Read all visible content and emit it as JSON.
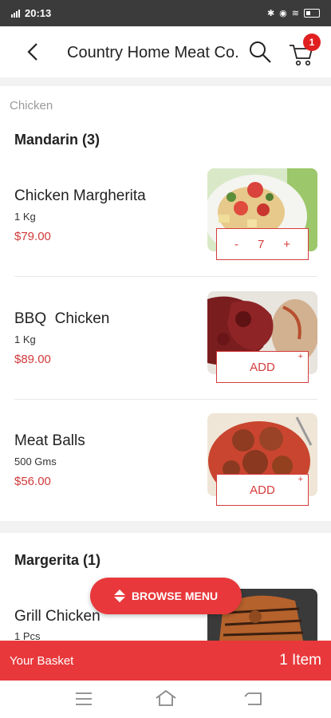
{
  "status_bar": {
    "time": "20:13"
  },
  "header": {
    "title": "Country Home Meat Co.",
    "cart_count": "1"
  },
  "breadcrumb": "Chicken",
  "sections": [
    {
      "title": "Mandarin (3)",
      "items": [
        {
          "name": "Chicken Margherita",
          "qty": "1 Kg",
          "price": "$79.00",
          "control": "stepper",
          "count": "7",
          "minus": "-",
          "plus": "+"
        },
        {
          "name": "BBQ  Chicken",
          "qty": "1 Kg",
          "price": "$89.00",
          "control": "add",
          "add_label": "ADD",
          "add_plus": "+"
        },
        {
          "name": "Meat Balls",
          "qty": "500 Gms",
          "price": "$56.00",
          "control": "add",
          "add_label": "ADD",
          "add_plus": "+"
        }
      ]
    },
    {
      "title": "Margerita (1)",
      "items": [
        {
          "name": "Grill Chicken",
          "qty": "1 Pcs"
        }
      ]
    }
  ],
  "browse_menu": {
    "label": "BROWSE MENU"
  },
  "basket": {
    "label": "Your Basket",
    "count": "1 Item"
  },
  "colors": {
    "accent": "#e8383b",
    "price": "#d23a3a",
    "statusbar": "#3b3b3b"
  },
  "icons": [
    "back-arrow-icon",
    "search-icon",
    "cart-icon",
    "browse-toggle-icon",
    "menu-icon",
    "home-icon",
    "return-icon"
  ]
}
